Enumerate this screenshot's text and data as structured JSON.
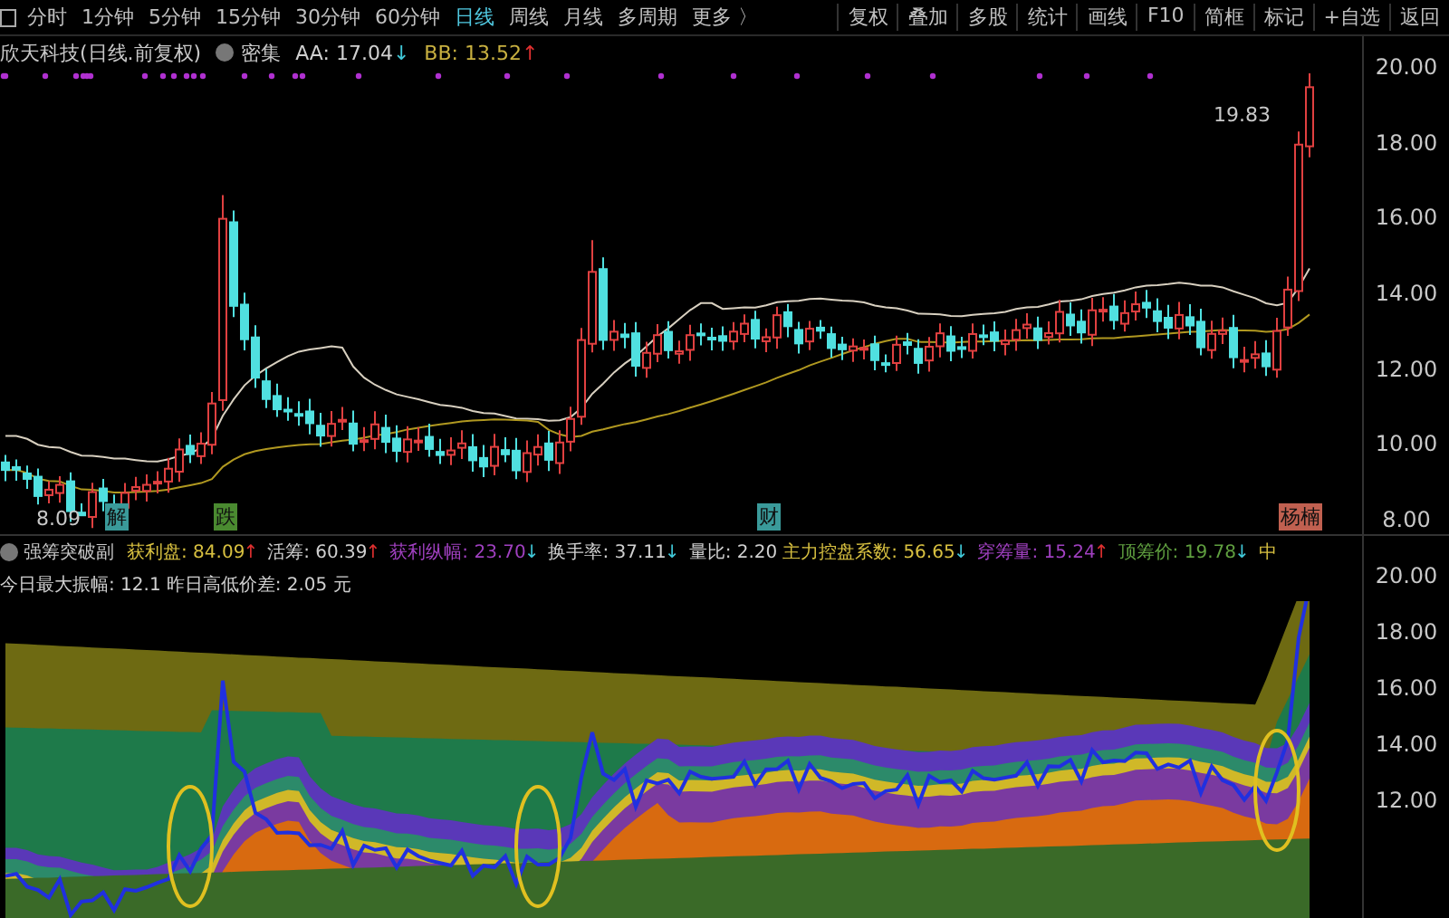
{
  "toolbar": {
    "periods": [
      {
        "label": "分时",
        "selected": false
      },
      {
        "label": "1分钟",
        "selected": false
      },
      {
        "label": "5分钟",
        "selected": false
      },
      {
        "label": "15分钟",
        "selected": false
      },
      {
        "label": "30分钟",
        "selected": false
      },
      {
        "label": "60分钟",
        "selected": false
      },
      {
        "label": "日线",
        "selected": true
      },
      {
        "label": "周线",
        "selected": false
      },
      {
        "label": "月线",
        "selected": false
      },
      {
        "label": "多周期",
        "selected": false
      },
      {
        "label": "更多 〉",
        "selected": false
      }
    ],
    "actions": [
      "复权",
      "叠加",
      "多股",
      "统计",
      "画线",
      "F10",
      "简框",
      "标记",
      "+自选",
      "返回"
    ]
  },
  "main_chart": {
    "title": "欣天科技(日线.前复权)",
    "indicator": "密集",
    "legend": [
      {
        "label": "AA: 17.04",
        "arrow": "↓",
        "rising": false,
        "color": "#d0d0d0"
      },
      {
        "label": "BB: 13.52",
        "arrow": "↑",
        "rising": true,
        "color": "#c8b040"
      }
    ],
    "price_labels": [
      {
        "kind": "high",
        "text": "19.83"
      },
      {
        "kind": "low",
        "text": "8.09"
      }
    ],
    "markers": [
      {
        "text": "解",
        "color": "#3a9a9a"
      },
      {
        "text": "跌",
        "color": "#4a8a30"
      },
      {
        "text": "财",
        "color": "#3a9a9a"
      },
      {
        "text": "杨楠",
        "color": "#c06050"
      }
    ],
    "axis": [
      "20.00",
      "18.00",
      "16.00",
      "14.00",
      "12.00",
      "10.00",
      "8.00"
    ]
  },
  "sub_chart": {
    "title": "强筹突破副",
    "legend": [
      {
        "label": "获利盘: 84.09",
        "arrow": "↑",
        "rising": true,
        "color": "#d8c040"
      },
      {
        "label": "活筹: 60.39",
        "arrow": "↑",
        "rising": true,
        "color": "#d0d0d0"
      },
      {
        "label": "获利纵幅: 23.70",
        "arrow": "↓",
        "rising": false,
        "color": "#a040c0"
      },
      {
        "label": "换手率: 37.11",
        "arrow": "↓",
        "rising": false,
        "color": "#d0d0d0"
      },
      {
        "label": "量比: 2.20",
        "color": "#d0d0d0"
      },
      {
        "label": "主力控盘系数: 56.65",
        "arrow": "↓",
        "rising": false,
        "color": "#d8c040"
      },
      {
        "label": "穿筹量: 15.24",
        "arrow": "↑",
        "rising": true,
        "color": "#a040c0"
      },
      {
        "label": "顶筹价: 19.78",
        "arrow": "↓",
        "rising": false,
        "color": "#60a040"
      },
      {
        "label": "中",
        "color": "#d8c040"
      }
    ],
    "notes": [
      "今日最大振幅: 12.1",
      "昨日高低价差: 2.05 元"
    ],
    "axis": [
      "20.00",
      "18.00",
      "16.00",
      "14.00",
      "12.00"
    ]
  }
}
